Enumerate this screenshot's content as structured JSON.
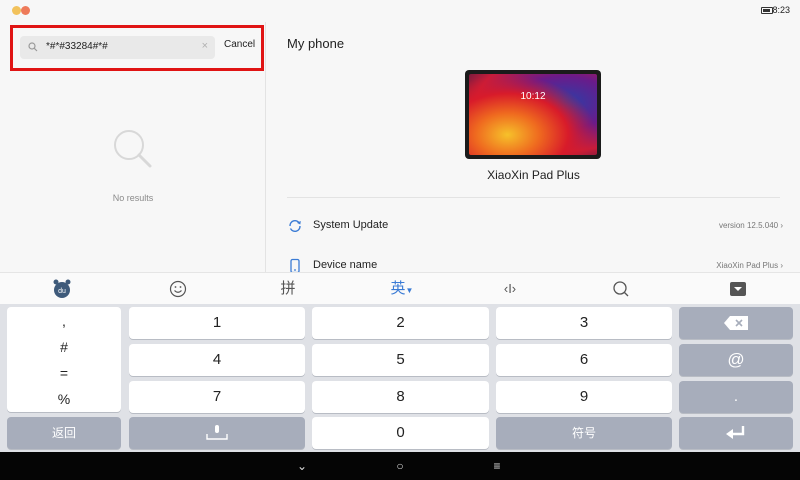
{
  "status_bar": {
    "time": "8:23"
  },
  "search": {
    "query": "*#*#33284#*#",
    "cancel_label": "Cancel",
    "no_results": "No results"
  },
  "main": {
    "title": "My phone",
    "device_screen_time": "10:12",
    "device_name": "XiaoXin Pad Plus",
    "rows": [
      {
        "label": "System Update",
        "value": "version 12.5.040",
        "icon": "refresh-icon"
      },
      {
        "label": "Device name",
        "value": "XiaoXin Pad Plus",
        "icon": "tablet-icon"
      }
    ]
  },
  "keyboard": {
    "toolbar": {
      "logo": "du",
      "pinyin": "拼",
      "english": "英",
      "cursor": "‹I›"
    },
    "symbols": [
      ",",
      "#",
      "=",
      "%"
    ],
    "digits": [
      "1",
      "2",
      "3",
      "4",
      "5",
      "6",
      "7",
      "8",
      "9",
      "0"
    ],
    "back_label": "返回",
    "symbols_label": "符号",
    "at_label": "@",
    "dot_label": "."
  },
  "colors": {
    "highlight_border": "#e01414",
    "accent": "#3a7bd5"
  }
}
